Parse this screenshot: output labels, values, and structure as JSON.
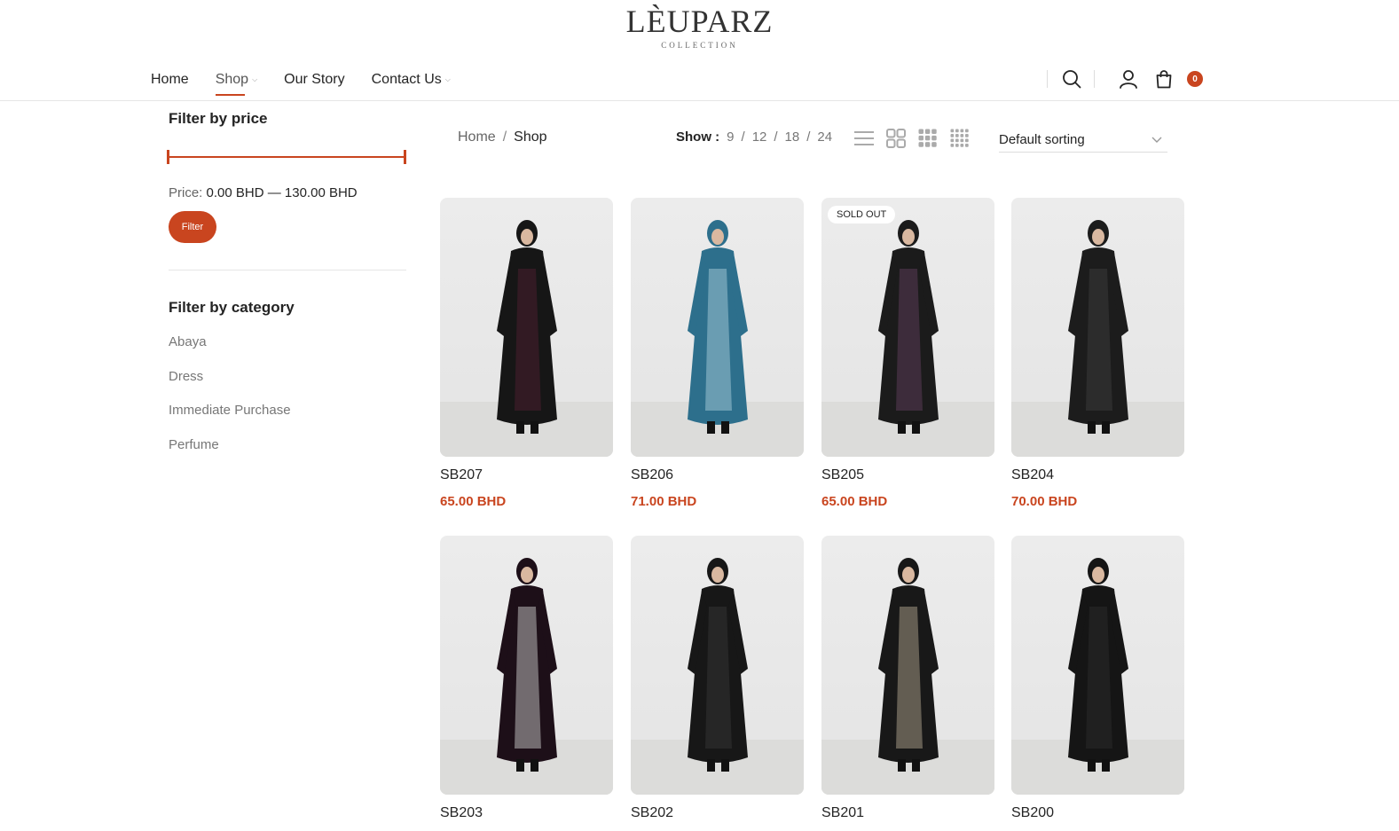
{
  "brand": {
    "name": "LÈUPARZ",
    "tagline": "COLLECTION"
  },
  "nav": [
    {
      "label": "Home",
      "dropdown": false,
      "active": false
    },
    {
      "label": "Shop",
      "dropdown": true,
      "active": true
    },
    {
      "label": "Our Story",
      "dropdown": false,
      "active": false
    },
    {
      "label": "Contact Us",
      "dropdown": true,
      "active": false
    }
  ],
  "header": {
    "cart_count": "0"
  },
  "colors": {
    "accent": "#c9451f",
    "text": "#242424",
    "muted": "#777777"
  },
  "sidebar": {
    "price_title": "Filter by price",
    "price_label": "Price:",
    "price_min": "0.00 BHD",
    "price_range_sep": "—",
    "price_max": "130.00 BHD",
    "filter_button": "Filter",
    "category_title": "Filter by category",
    "categories": [
      "Abaya",
      "Dress",
      "Immediate Purchase",
      "Perfume"
    ]
  },
  "breadcrumb": {
    "home": "Home",
    "separator": "/",
    "current": "Shop"
  },
  "toolbar": {
    "show_label": "Show :",
    "per_page": [
      "9",
      "12",
      "18",
      "24"
    ],
    "view_modes": [
      "list-view-icon",
      "grid-2-icon",
      "grid-3-icon",
      "grid-4-icon"
    ],
    "sorting": "Default sorting"
  },
  "products": [
    {
      "name": "SB207",
      "price": "65.00 BHD",
      "badge": "",
      "outfit": "#161616",
      "accent": "#4a1f30"
    },
    {
      "name": "SB206",
      "price": "71.00 BHD",
      "badge": "",
      "outfit": "#2d6f8c",
      "accent": "#9cc3d2"
    },
    {
      "name": "SB205",
      "price": "65.00 BHD",
      "badge": "SOLD OUT",
      "outfit": "#1b1b1b",
      "accent": "#5a3a55"
    },
    {
      "name": "SB204",
      "price": "70.00 BHD",
      "badge": "",
      "outfit": "#1c1c1c",
      "accent": "#3a3a3a"
    },
    {
      "name": "SB203",
      "price": "",
      "badge": "",
      "outfit": "#1d0f18",
      "accent": "#b8b8b8"
    },
    {
      "name": "SB202",
      "price": "",
      "badge": "",
      "outfit": "#171717",
      "accent": "#333333"
    },
    {
      "name": "SB201",
      "price": "",
      "badge": "",
      "outfit": "#181818",
      "accent": "#a39884"
    },
    {
      "name": "SB200",
      "price": "",
      "badge": "",
      "outfit": "#151515",
      "accent": "#2a2a2a"
    }
  ]
}
